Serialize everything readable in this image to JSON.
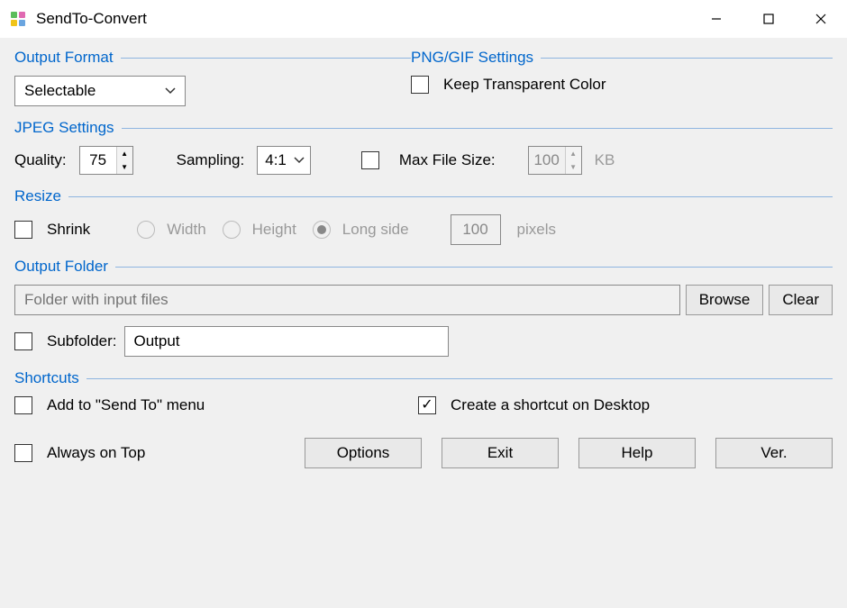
{
  "titlebar": {
    "title": "SendTo-Convert"
  },
  "outputFormat": {
    "header": "Output Format",
    "selected": "Selectable"
  },
  "pngGif": {
    "header": "PNG/GIF Settings",
    "keepTransparent": "Keep Transparent Color"
  },
  "jpeg": {
    "header": "JPEG Settings",
    "qualityLabel": "Quality:",
    "qualityValue": "75",
    "samplingLabel": "Sampling:",
    "samplingValue": "4:1",
    "maxFileSizeLabel": "Max File Size:",
    "maxFileSizeValue": "100",
    "maxFileSizeUnit": "KB"
  },
  "resize": {
    "header": "Resize",
    "shrink": "Shrink",
    "width": "Width",
    "height": "Height",
    "longSide": "Long side",
    "pixelsValue": "100",
    "pixelsLabel": "pixels"
  },
  "outputFolder": {
    "header": "Output Folder",
    "placeholder": "Folder with input files",
    "browse": "Browse",
    "clear": "Clear",
    "subfolderLabel": "Subfolder:",
    "subfolderValue": "Output"
  },
  "shortcuts": {
    "header": "Shortcuts",
    "addSendTo": "Add to \"Send To\" menu",
    "createDesktop": "Create a shortcut on Desktop"
  },
  "footer": {
    "alwaysOnTop": "Always on Top",
    "options": "Options",
    "exit": "Exit",
    "help": "Help",
    "ver": "Ver."
  }
}
